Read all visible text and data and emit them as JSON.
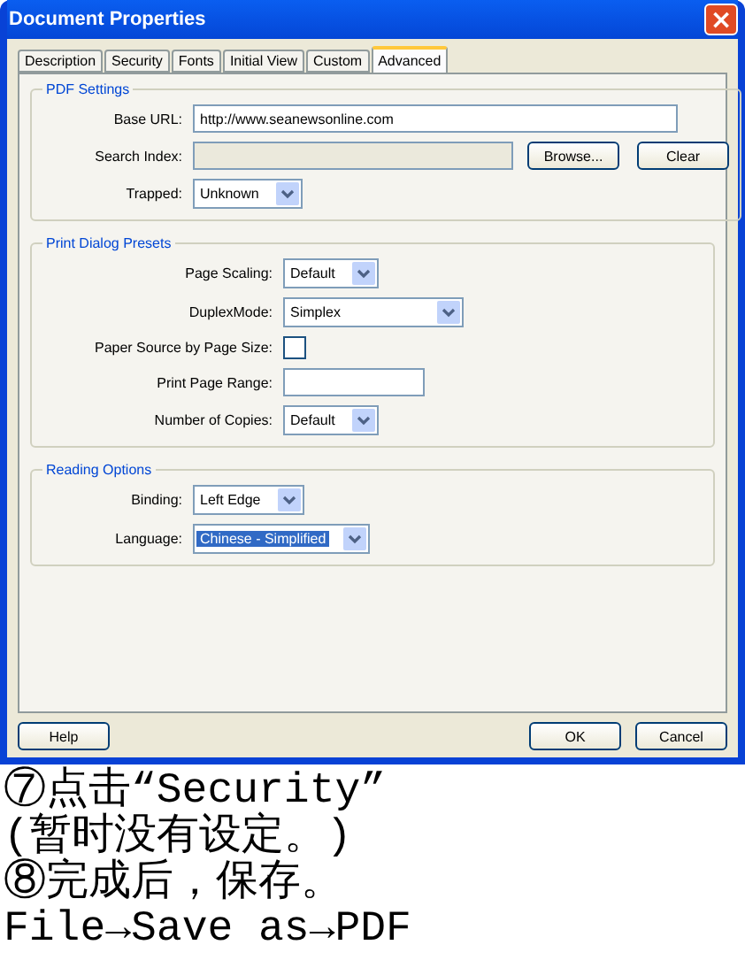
{
  "window": {
    "title": "Document Properties",
    "close": "×"
  },
  "tabs": [
    {
      "label": "Description",
      "selected": false
    },
    {
      "label": "Security",
      "selected": false
    },
    {
      "label": "Fonts",
      "selected": false
    },
    {
      "label": "Initial View",
      "selected": false
    },
    {
      "label": "Custom",
      "selected": false
    },
    {
      "label": "Advanced",
      "selected": true
    }
  ],
  "groups": [
    {
      "title": "PDF Settings",
      "rows": [
        {
          "kind": "text",
          "label": "Base URL:",
          "value": "http://www.seanewsonline.com"
        },
        {
          "kind": "text",
          "label": "Search Index:",
          "disabled": true,
          "buttons": [
            "Browse...",
            "Clear"
          ]
        },
        {
          "kind": "dropdown",
          "label": "Trapped:",
          "value": "Unknown"
        }
      ]
    },
    {
      "title": "Print Dialog Presets",
      "rows": [
        {
          "kind": "dropdown",
          "label": "Page Scaling:",
          "value": "Default"
        },
        {
          "kind": "dropdown",
          "label": "DuplexMode:",
          "value": "Simplex"
        },
        {
          "kind": "checkbox",
          "label": "Paper Source by Page Size:",
          "checked": false
        },
        {
          "kind": "text",
          "label": "Print Page Range:"
        },
        {
          "kind": "dropdown",
          "label": "Number of Copies:",
          "value": "Default"
        }
      ]
    },
    {
      "title": "Reading Options",
      "rows": [
        {
          "kind": "dropdown",
          "label": "Binding:",
          "value": "Left Edge"
        },
        {
          "kind": "dropdown",
          "label": "Language:",
          "value": "Chinese - Simplified",
          "selected": true
        }
      ]
    }
  ],
  "footer": {
    "help": "Help",
    "ok": "OK",
    "cancel": "Cancel"
  },
  "caption": [
    "⑦点击“Security”",
    "(暂时没有设定。)",
    "⑧完成后，保存。",
    "File→Save as→PDF"
  ]
}
